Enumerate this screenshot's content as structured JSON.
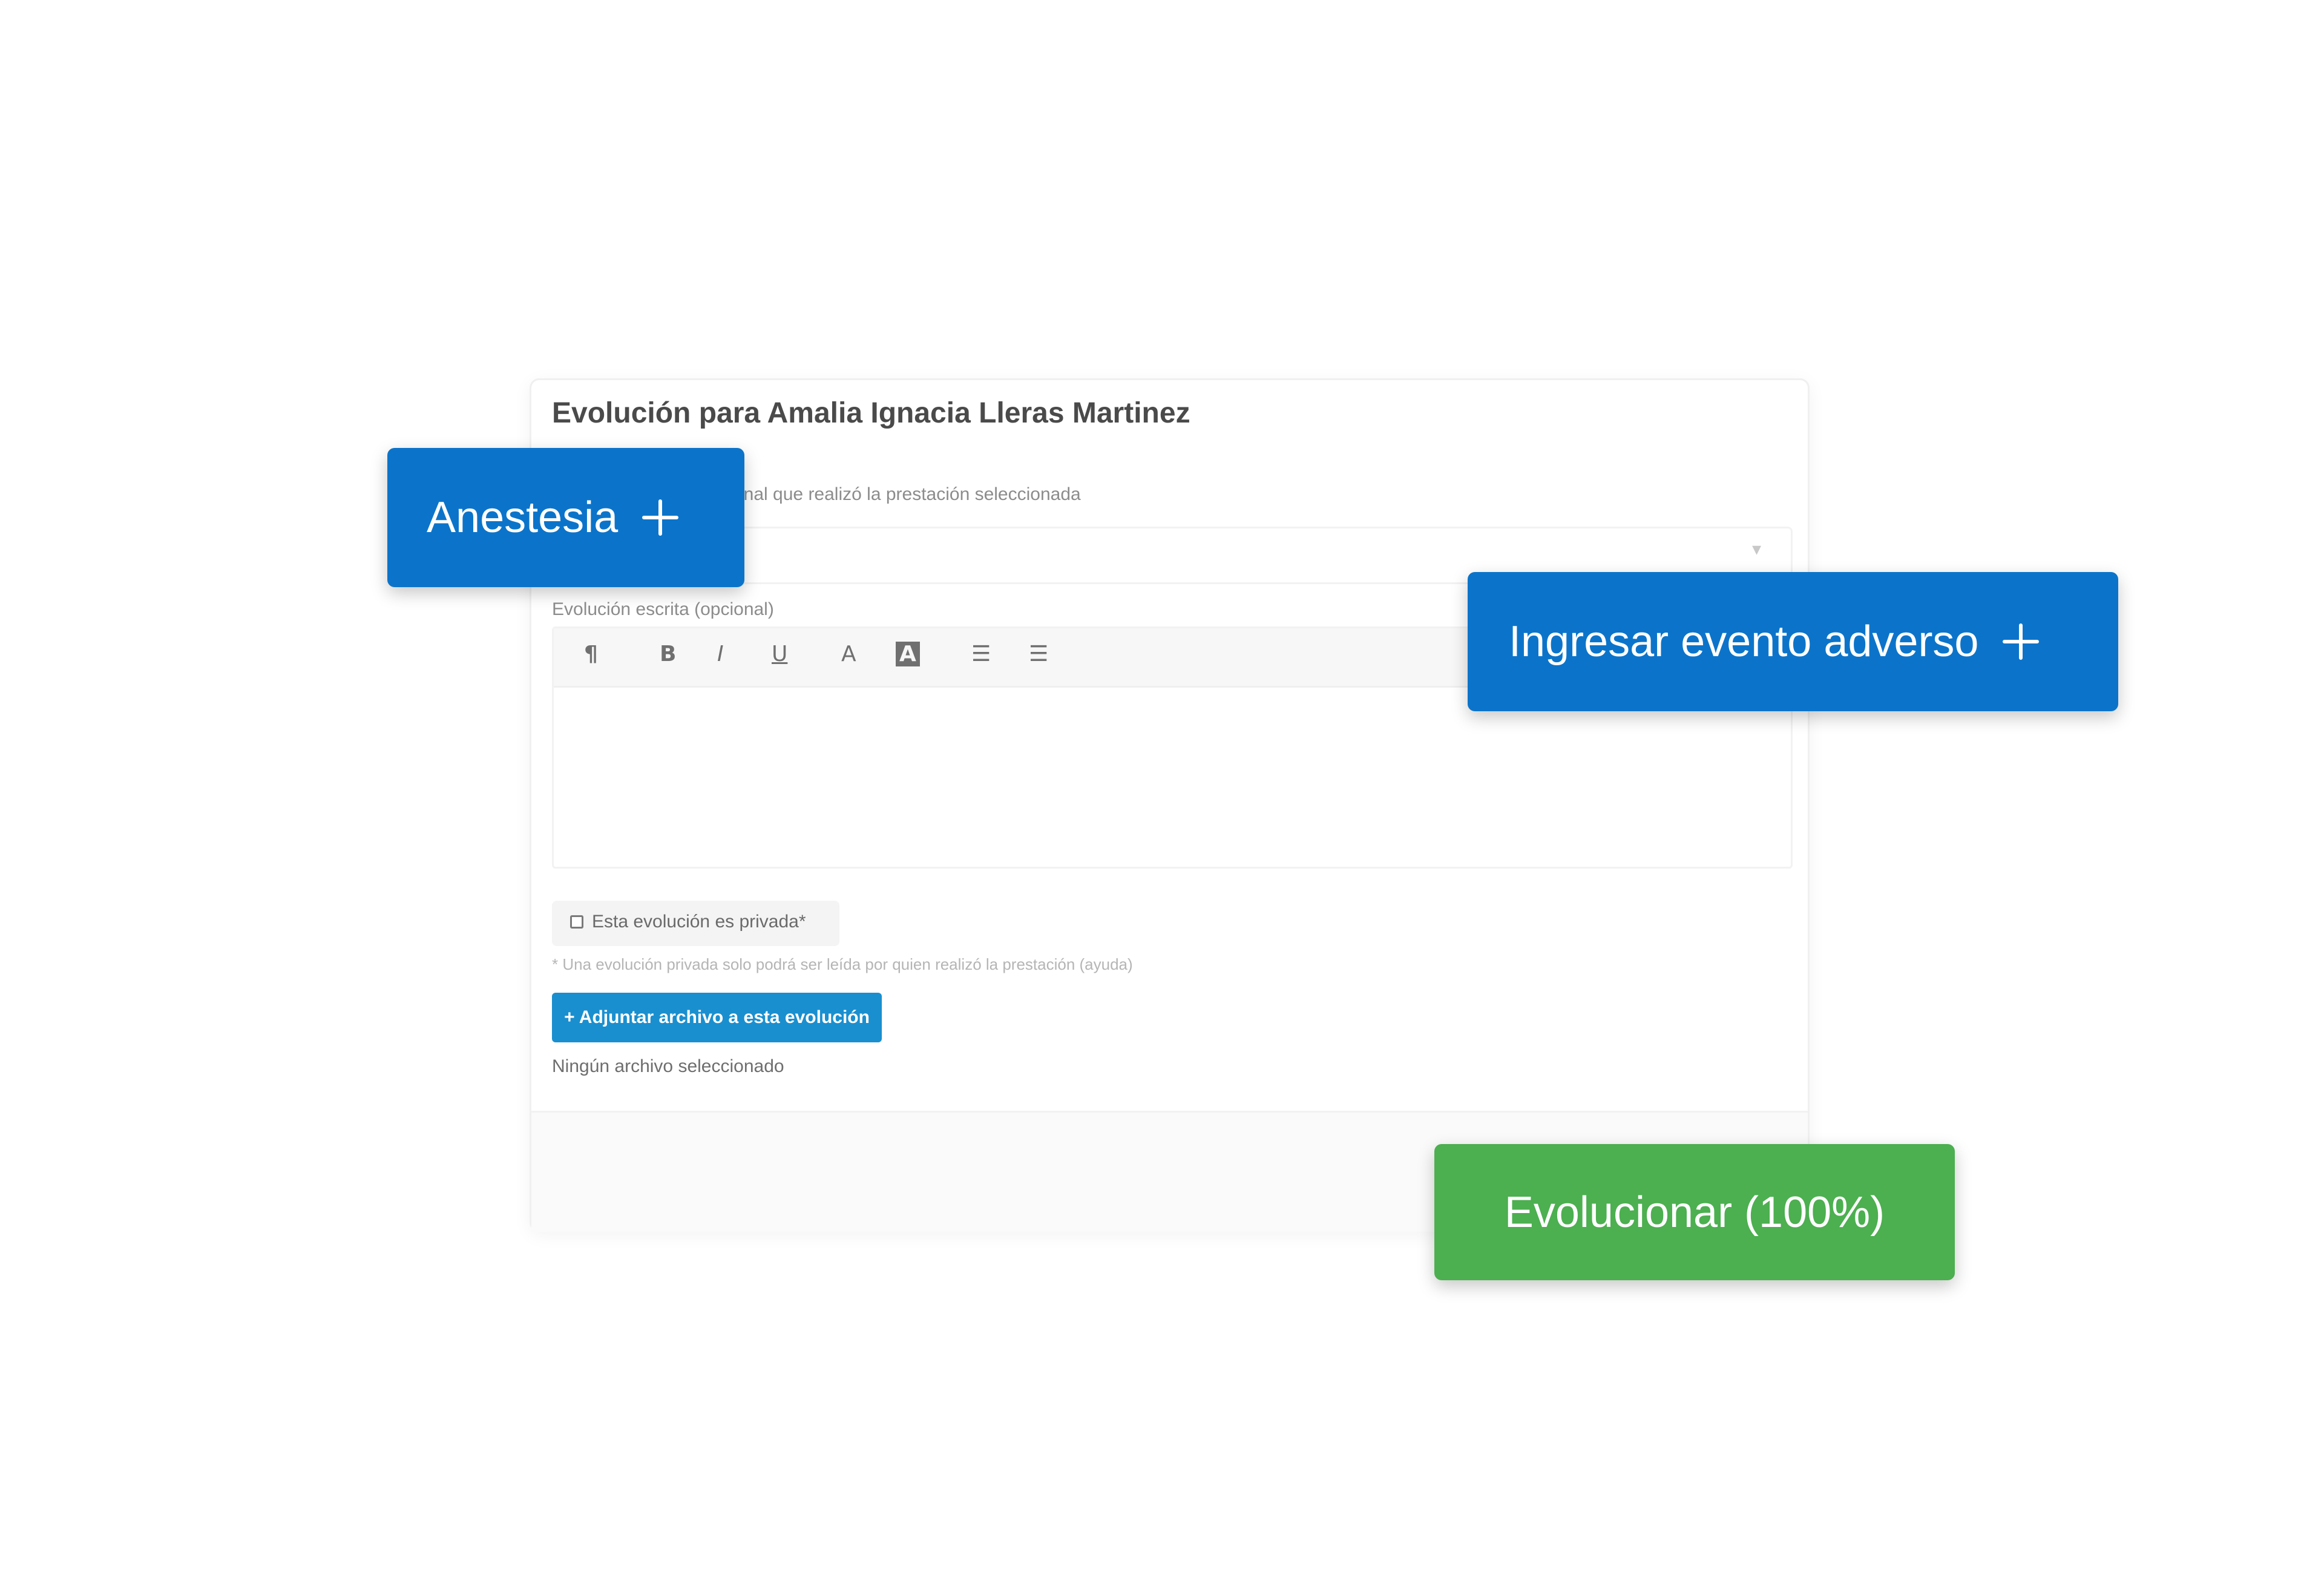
{
  "card": {
    "title": "Evolución para Amalia Ignacia Lleras Martinez",
    "professional_label": "onal que realizó la prestación seleccionada",
    "written_evolution_label": "Evolución escrita (opcional)",
    "toolbar": {
      "paragraph": "¶",
      "bold": "B",
      "italic": "I",
      "underline": "U",
      "font_color": "A",
      "highlight": "A",
      "bullet_list": "☰",
      "numbered_list": "☰"
    },
    "private_checkbox_label": "Esta evolución es privada*",
    "private_note": "* Una evolución privada solo podrá ser leída por quien realizó la prestación (ayuda)",
    "attach_button": "+ Adjuntar archivo a esta evolución",
    "no_file_text": "Ningún archivo seleccionado"
  },
  "floating_buttons": {
    "anesthesia": "Anestesia",
    "adverse_event": "Ingresar evento adverso",
    "evolve": "Evolucionar (100%)"
  },
  "colors": {
    "primary_blue": "#0b74ca",
    "attach_blue": "#1a8fcf",
    "success_green": "#4caf50"
  }
}
